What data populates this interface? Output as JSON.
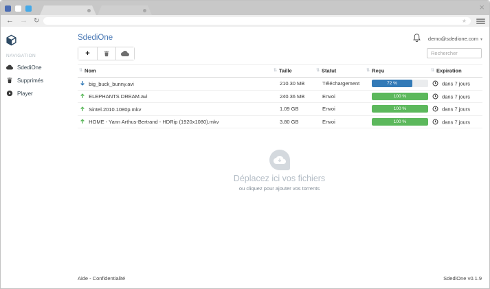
{
  "colors": {
    "accent_blue": "#4a79b5",
    "progress_blue": "#337ab7",
    "progress_green": "#5cb85c",
    "window_dot_dark_blue": "#4a6cb3",
    "window_dot_white": "#ffffff",
    "window_dot_light_blue": "#45a9e8"
  },
  "browser": {
    "close_label": "×",
    "back_label": "←",
    "forward_label": "→",
    "reload_label": "↻",
    "bookmark_star": "★",
    "address_value": ""
  },
  "sidebar": {
    "section_label": "NAVIGATION",
    "items": [
      {
        "label": "SdediOne"
      },
      {
        "label": "Supprimés"
      },
      {
        "label": "Player"
      }
    ]
  },
  "header": {
    "title": "SdediOne",
    "account_email": "demo@sdedione.com",
    "caret": "▾"
  },
  "toolbar": {
    "add_label": "+",
    "search_placeholder": "Rechercher"
  },
  "table": {
    "headers": [
      "Nom",
      "Taille",
      "Statut",
      "Reçu",
      "Expiration"
    ],
    "sort_glyph": "⇅",
    "rows": [
      {
        "direction": "download",
        "name": "big_buck_bunny.avi",
        "size": "210.30 MB",
        "status": "Téléchargement",
        "progress": 72,
        "progress_label": "72 %",
        "expiration": "dans 7 jours"
      },
      {
        "direction": "upload",
        "name": "ELEPHANTS DREAM.avi",
        "size": "240.36 MB",
        "status": "Envoi",
        "progress": 100,
        "progress_label": "100 %",
        "expiration": "dans 7 jours"
      },
      {
        "direction": "upload",
        "name": "Sintel.2010.1080p.mkv",
        "size": "1.09 GB",
        "status": "Envoi",
        "progress": 100,
        "progress_label": "100 %",
        "expiration": "dans 7 jours"
      },
      {
        "direction": "upload",
        "name": "HOME - Yann Arthus-Bertrand - HDRip (1920x1080).mkv",
        "size": "3.80 GB",
        "status": "Envoi",
        "progress": 100,
        "progress_label": "100 %",
        "expiration": "dans 7 jours"
      }
    ]
  },
  "dropzone": {
    "title": "Déplacez ici vos fichiers",
    "subtitle": "ou cliquez pour ajouter vos torrents"
  },
  "footer": {
    "left": "Aide - Confidentialité",
    "right": "SdediOne v0.1.9"
  }
}
